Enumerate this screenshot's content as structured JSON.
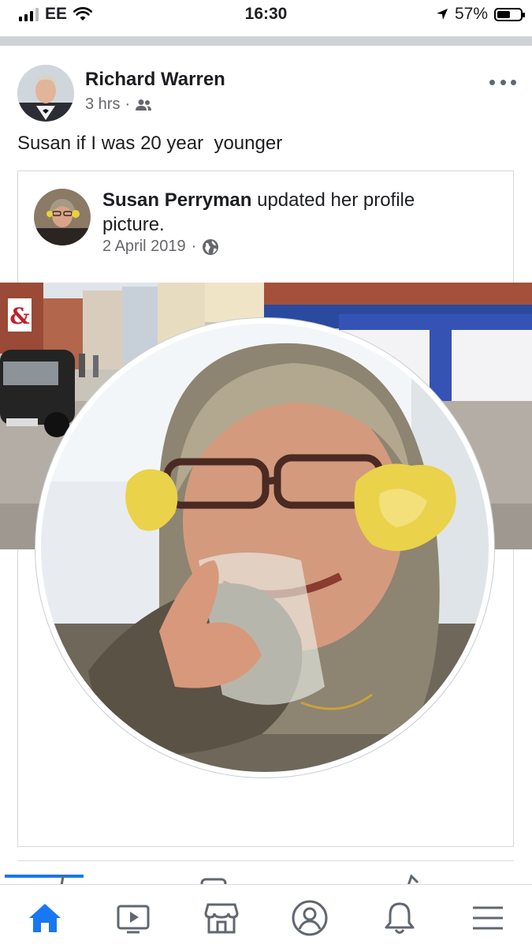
{
  "status_bar": {
    "carrier": "EE",
    "time": "16:30",
    "battery": "57%",
    "battery_level": 0.57
  },
  "post": {
    "author": "Richard Warren",
    "time": "3 hrs",
    "audience_icon": "friends-icon",
    "text": "Susan if I was 20 year  younger"
  },
  "shared_post": {
    "author": "Susan Perryman",
    "action": " updated her profile picture.",
    "date": "2 April 2019",
    "audience_icon": "globe-icon"
  },
  "tab_bar": {
    "items": [
      {
        "name": "home-icon",
        "active": true
      },
      {
        "name": "watch-icon",
        "active": false
      },
      {
        "name": "marketplace-icon",
        "active": false
      },
      {
        "name": "profile-icon",
        "active": false
      },
      {
        "name": "notifications-icon",
        "active": false
      },
      {
        "name": "menu-icon",
        "active": false
      }
    ]
  },
  "colors": {
    "accent": "#1877f2",
    "text": "#1c1e21",
    "secondary_text": "#65676b",
    "divider": "#cfd2d6"
  }
}
